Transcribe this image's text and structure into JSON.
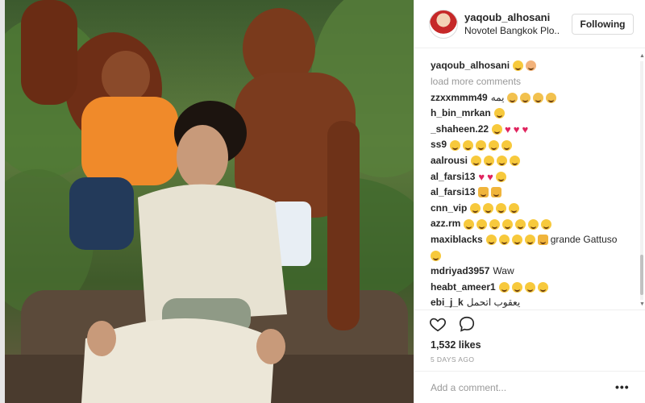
{
  "post": {
    "username": "yaqoub_alhosani",
    "location": "Novotel Bangkok Plo..",
    "follow_label": "Following"
  },
  "caption": {
    "username": "yaqoub_alhosani"
  },
  "load_more": "load more comments",
  "comments": [
    {
      "user": "zzxxmmm49",
      "text": "يمه",
      "icons": [
        "sad-face-emoji",
        "sad-face-emoji",
        "sad-face-emoji",
        "sad-face-emoji"
      ]
    },
    {
      "user": "h_bin_mrkan",
      "text": "",
      "icons": [
        "laughing-emoji"
      ]
    },
    {
      "user": "_shaheen.22",
      "text": "",
      "icons": [
        "laughing-emoji",
        "heart",
        "heart",
        "heart"
      ]
    },
    {
      "user": "ss9",
      "text": "",
      "icons": [
        "laughing-emoji",
        "laughing-emoji",
        "laughing-emoji",
        "laughing-emoji",
        "laughing-emoji"
      ]
    },
    {
      "user": "aalrousi",
      "text": "",
      "icons": [
        "laughing-emoji",
        "laughing-emoji",
        "laughing-emoji",
        "laughing-emoji"
      ]
    },
    {
      "user": "al_farsi13",
      "text": "",
      "icons": [
        "heart",
        "heart",
        "laughing-emoji"
      ]
    },
    {
      "user": "al_farsi13",
      "text": "",
      "icons": [
        "thumbs-up-emoji",
        "clap-emoji"
      ]
    },
    {
      "user": "cnn_vip",
      "text": "",
      "icons": [
        "laughing-emoji",
        "laughing-emoji",
        "laughing-emoji",
        "laughing-emoji"
      ]
    },
    {
      "user": "azz.rm",
      "text": "",
      "icons": [
        "laughing-emoji",
        "laughing-emoji",
        "laughing-emoji",
        "laughing-emoji",
        "laughing-emoji",
        "laughing-emoji",
        "laughing-emoji"
      ]
    },
    {
      "user": "maxiblacks",
      "text": "grande Gattuso",
      "icons": [
        "laughing-emoji",
        "laughing-emoji",
        "laughing-emoji",
        "laughing-emoji",
        "clap-emoji"
      ]
    },
    {
      "user": "",
      "text": "",
      "icons": [
        "laughing-emoji"
      ]
    },
    {
      "user": "mdriyad3957",
      "text": "Waw",
      "icons": []
    },
    {
      "user": "heabt_ameer1",
      "text": "",
      "icons": [
        "laughing-emoji",
        "laughing-emoji",
        "laughing-emoji",
        "laughing-emoji"
      ]
    },
    {
      "user": "ebi_j_k",
      "text": "يعقوب اتحمل",
      "icons": []
    }
  ],
  "likes": "1,532 likes",
  "timestamp": "5 DAYS AGO",
  "add_comment_placeholder": "Add a comment...",
  "more_options": "•••",
  "colors": {
    "heart": "#e0245e",
    "emoji": "#f7c93c",
    "muted": "#999999"
  },
  "icons": {
    "like": "heart-outline-icon",
    "comment": "comment-bubble-icon",
    "more": "more-options-icon"
  }
}
